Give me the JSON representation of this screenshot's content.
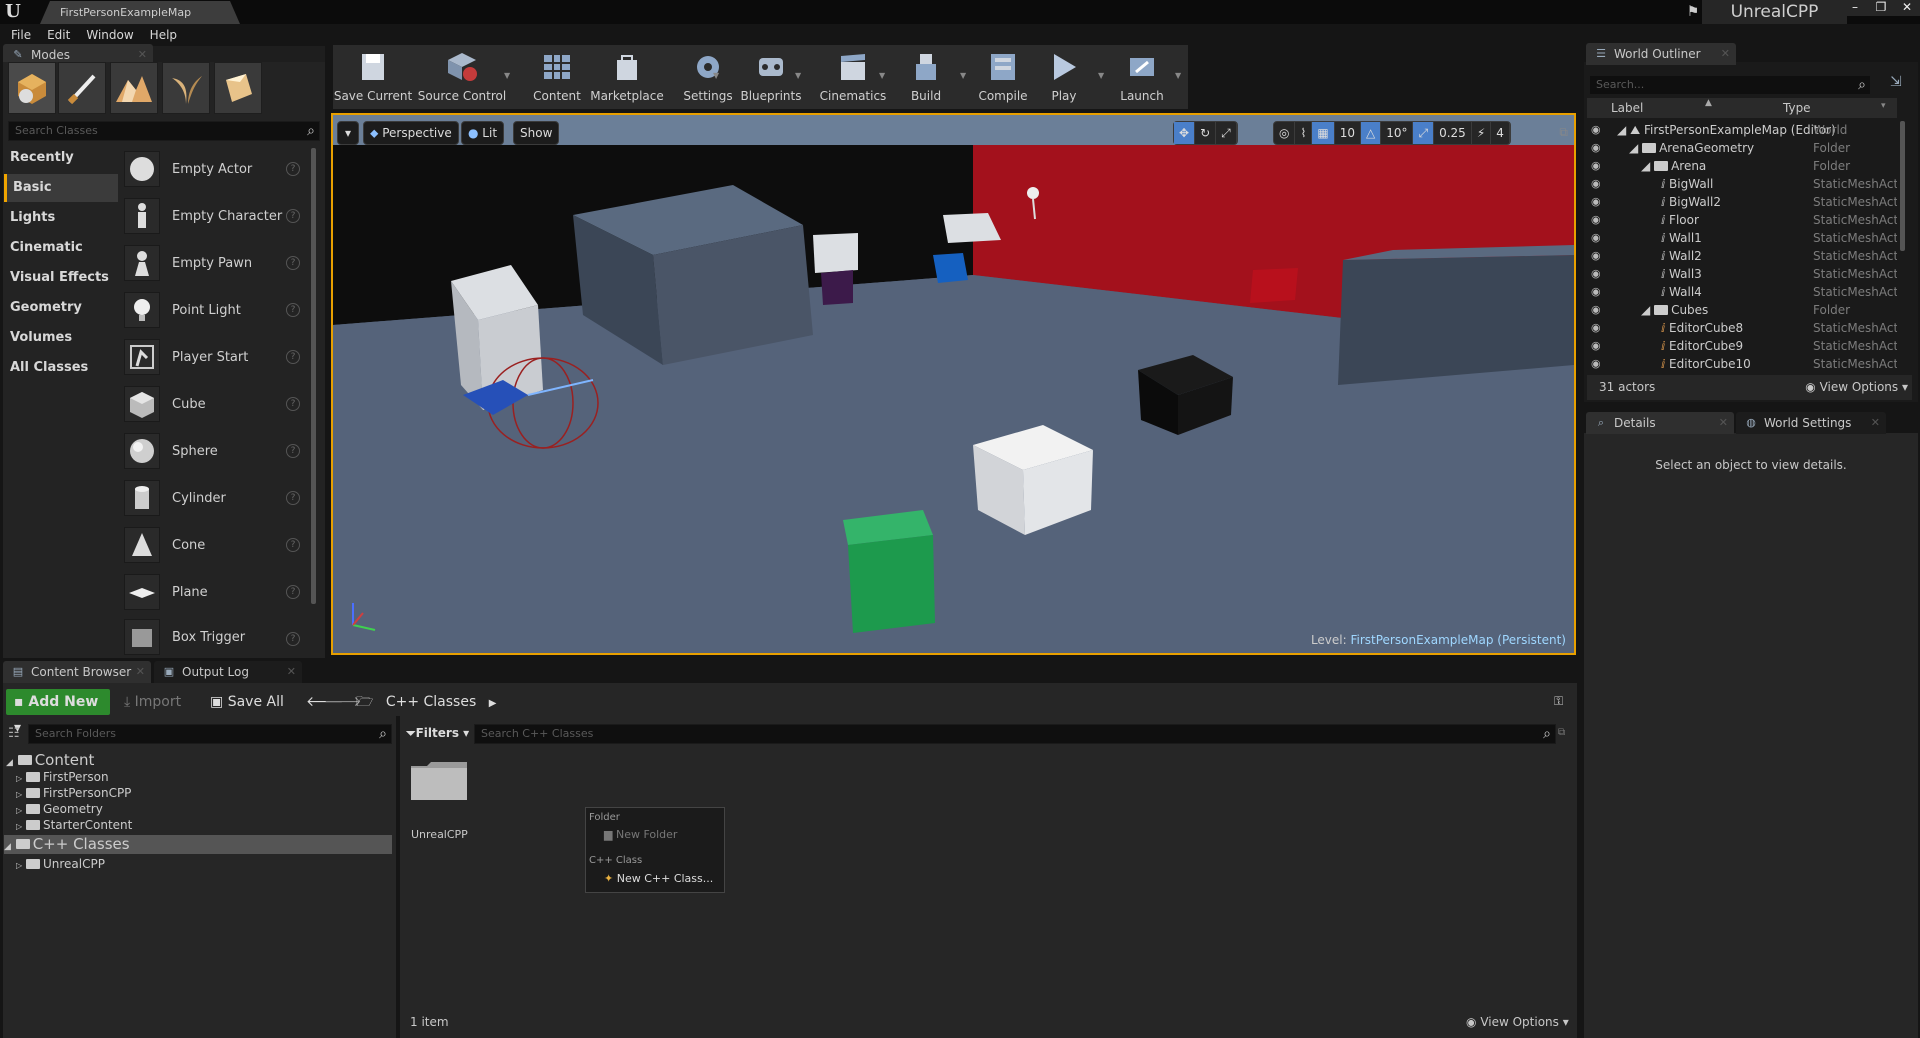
{
  "window": {
    "document_tab": "FirstPersonExampleMap",
    "project_name": "UnrealCPP",
    "controls": [
      "–",
      "❐",
      "✕"
    ]
  },
  "menu": [
    "File",
    "Edit",
    "Window",
    "Help"
  ],
  "modes": {
    "tab": "Modes",
    "search_placeholder": "Search Classes",
    "categories": [
      "Recently Placed",
      "Basic",
      "Lights",
      "Cinematic",
      "Visual Effects",
      "Geometry",
      "Volumes",
      "All Classes"
    ],
    "selected_category": "Basic",
    "items": [
      "Empty Actor",
      "Empty Character",
      "Empty Pawn",
      "Point Light",
      "Player Start",
      "Cube",
      "Sphere",
      "Cylinder",
      "Cone",
      "Plane",
      "Box Trigger"
    ]
  },
  "toolbar": {
    "buttons": [
      "Save Current",
      "Source Control",
      "Content",
      "Marketplace",
      "Settings",
      "Blueprints",
      "Cinematics",
      "Build",
      "Compile",
      "Play",
      "Launch"
    ]
  },
  "viewport": {
    "perspective": "Perspective",
    "lit": "Lit",
    "show": "Show",
    "grid_snap": "10",
    "rot_snap": "10°",
    "scale_snap": "0.25",
    "camera_speed": "4",
    "level_label": "Level:",
    "level_name": "FirstPersonExampleMap (Persistent)"
  },
  "outliner": {
    "tab": "World Outliner",
    "search_placeholder": "Search...",
    "col_label": "Label",
    "col_type": "Type",
    "rows": [
      {
        "name": "FirstPersonExampleMap (Editor)",
        "type": "World"
      },
      {
        "name": "ArenaGeometry",
        "type": "Folder"
      },
      {
        "name": "Arena",
        "type": "Folder"
      },
      {
        "name": "BigWall",
        "type": "StaticMeshActor"
      },
      {
        "name": "BigWall2",
        "type": "StaticMeshActor"
      },
      {
        "name": "Floor",
        "type": "StaticMeshActor"
      },
      {
        "name": "Wall1",
        "type": "StaticMeshActor"
      },
      {
        "name": "Wall2",
        "type": "StaticMeshActor"
      },
      {
        "name": "Wall3",
        "type": "StaticMeshActor"
      },
      {
        "name": "Wall4",
        "type": "StaticMeshActor"
      },
      {
        "name": "Cubes",
        "type": "Folder"
      },
      {
        "name": "EditorCube8",
        "type": "StaticMeshActor"
      },
      {
        "name": "EditorCube9",
        "type": "StaticMeshActor"
      },
      {
        "name": "EditorCube10",
        "type": "StaticMeshActor"
      }
    ],
    "actor_count": "31 actors",
    "view_options": "View Options"
  },
  "details": {
    "tab_details": "Details",
    "tab_world_settings": "World Settings",
    "empty_message": "Select an object to view details."
  },
  "content_browser": {
    "tab": "Content Browser",
    "output_log_tab": "Output Log",
    "add_new": "Add New",
    "import": "Import",
    "save_all": "Save All",
    "path": "C++ Classes",
    "folder_search_placeholder": "Search Folders",
    "filters": "Filters",
    "asset_search_placeholder": "Search C++ Classes",
    "tree": [
      "Content",
      "FirstPerson",
      "FirstPersonCPP",
      "Geometry",
      "StarterContent",
      "C++ Classes",
      "UnrealCPP"
    ],
    "asset_name": "UnrealCPP",
    "item_count": "1 item",
    "view_options": "View Options"
  },
  "context_menu": {
    "folder_header": "Folder",
    "new_folder": "New Folder",
    "class_header": "C++ Class",
    "new_class": "New C++ Class..."
  }
}
